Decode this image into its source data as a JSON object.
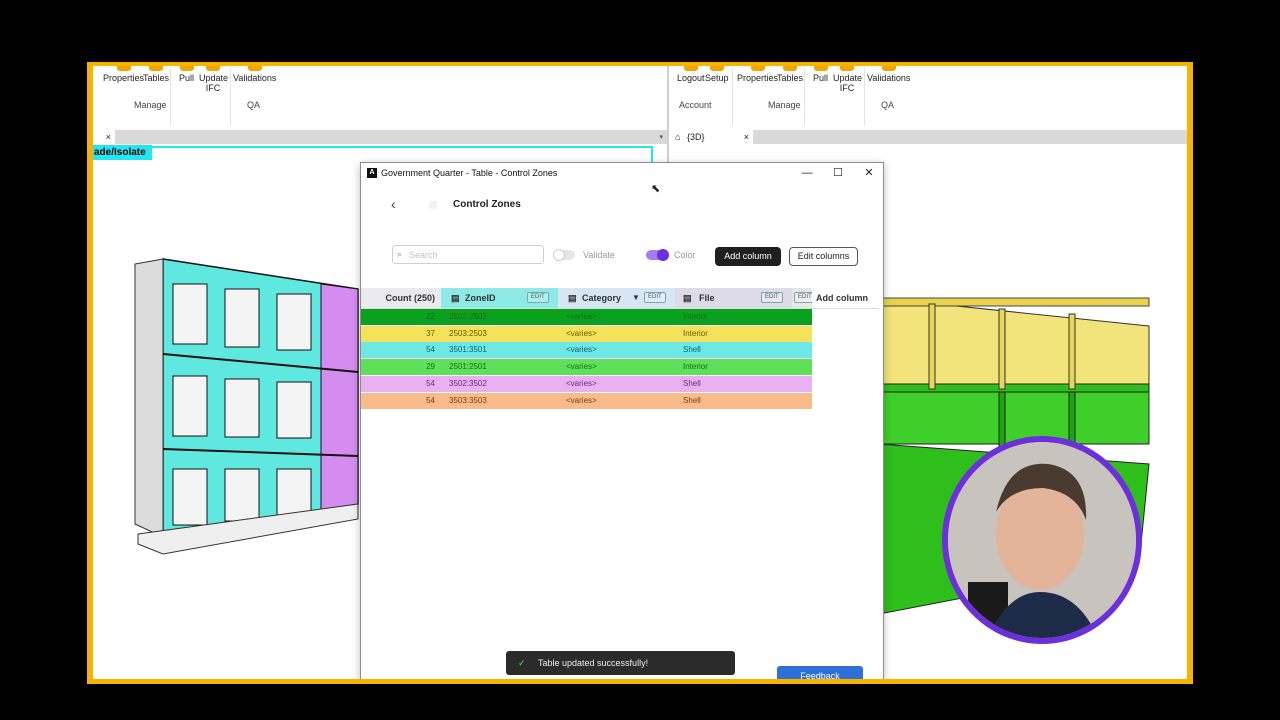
{
  "ribbon_left": {
    "buttons": [
      "Properties",
      "Tables",
      "Pull",
      "Update IFC",
      "Validations"
    ],
    "groups": [
      "Manage",
      "QA"
    ]
  },
  "ribbon_right": {
    "buttons": [
      "Logout",
      "Setup",
      "Properties",
      "Tables",
      "Pull",
      "Update IFC",
      "Validations"
    ],
    "groups": [
      "Account",
      "Manage",
      "QA"
    ]
  },
  "left_view": {
    "close": "×",
    "isolate_label": "ade/Isolate"
  },
  "right_view": {
    "tab_label": "{3D}",
    "close": "×"
  },
  "dialog": {
    "window_title": "Government Quarter - Table - Control Zones",
    "app_icon": "A",
    "minimize": "—",
    "maximize": "☐",
    "close": "✕",
    "page_title": "Control Zones",
    "search_placeholder": "Search",
    "validate_label": "Validate",
    "color_label": "Color",
    "add_column_label": "Add column",
    "edit_columns_label": "Edit columns",
    "columns": {
      "count": "Count (250)",
      "zone": "ZoneID",
      "category": "Category",
      "file": "File",
      "add": "Add column",
      "edit": "EDIT"
    },
    "rows": [
      {
        "count": "22",
        "zone": "2502:2502",
        "category": "<varies>",
        "file": "Interior",
        "color": "#0aa11e",
        "text": "#1b6b1b"
      },
      {
        "count": "37",
        "zone": "2503:2503",
        "category": "<varies>",
        "file": "Interior",
        "color": "#f4e35a",
        "text": "#6b5a00"
      },
      {
        "count": "54",
        "zone": "3501:3501",
        "category": "<varies>",
        "file": "Shell",
        "color": "#6ee8e6",
        "text": "#145f6e"
      },
      {
        "count": "29",
        "zone": "2501:2501",
        "category": "<varies>",
        "file": "Interior",
        "color": "#5fe05a",
        "text": "#1d6a1d"
      },
      {
        "count": "54",
        "zone": "3502:3502",
        "category": "<varies>",
        "file": "Shell",
        "color": "#e9b0f2",
        "text": "#6a2d7a"
      },
      {
        "count": "54",
        "zone": "3503:3503",
        "category": "<varies>",
        "file": "Shell",
        "color": "#f8bb8a",
        "text": "#7a3f10"
      }
    ],
    "toast": "Table updated successfully!",
    "feedback": "Feedback"
  }
}
